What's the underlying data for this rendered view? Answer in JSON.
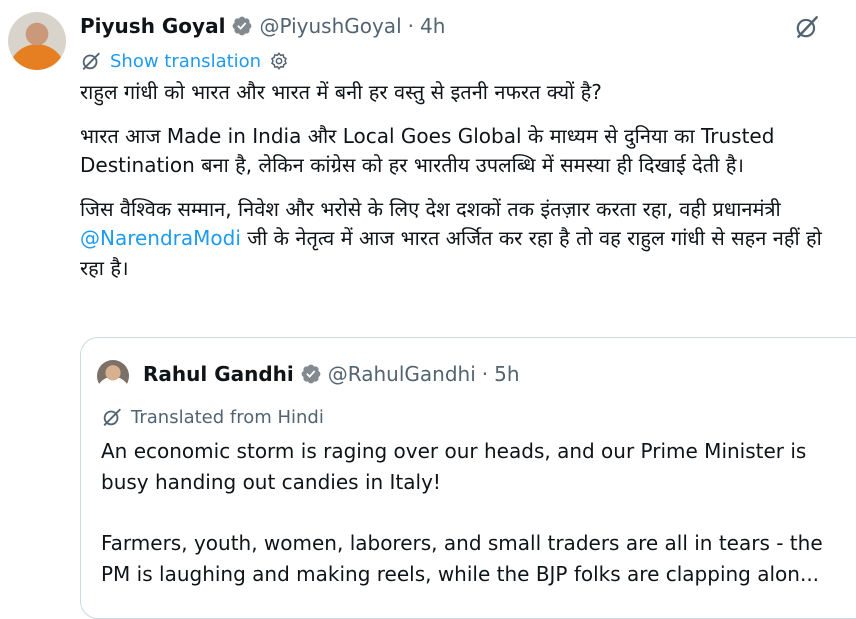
{
  "tweet": {
    "author_name": "Piyush Goyal",
    "author_handle": "@PiyushGoyal",
    "separator": "·",
    "time": "4h",
    "show_translation_label": "Show translation",
    "paragraph_1": "राहुल गांधी को भारत और भारत में बनी हर वस्तु से इतनी नफरत क्यों है?",
    "paragraph_2": "भारत आज Made in India और Local Goes Global के माध्यम से दुनिया का Trusted Destination बना है, लेकिन कांग्रेस को हर भारतीय उपलब्धि में समस्या ही दिखाई देती है।",
    "paragraph_3_before": "जिस वैश्विक सम्मान, निवेश और भरोसे के लिए देश दशकों तक इंतज़ार करता रहा, वही प्रधानमंत्री ",
    "paragraph_3_mention": "@NarendraModi",
    "paragraph_3_after": " जी के नेतृत्व में आज भारत अर्जित कर रहा है तो वह राहुल गांधी से सहन नहीं हो रहा है।"
  },
  "quoted_tweet": {
    "author_name": "Rahul Gandhi",
    "author_handle": "@RahulGandhi",
    "separator": "·",
    "time": "5h",
    "translated_label": "Translated from Hindi",
    "paragraph_1": "An economic storm is raging over our heads, and our Prime Minister is busy handing out candies in Italy!",
    "paragraph_2": "Farmers, youth, women, laborers, and small traders are all in tears - the PM is laughing and making reels, while the BJP folks are clapping alon..."
  },
  "colors": {
    "accent": "#1d9bf0",
    "secondary_text": "#536471",
    "border": "#cfd9de"
  },
  "icons": [
    "verified-badge-icon",
    "grok-icon",
    "translate-icon",
    "gear-icon"
  ]
}
